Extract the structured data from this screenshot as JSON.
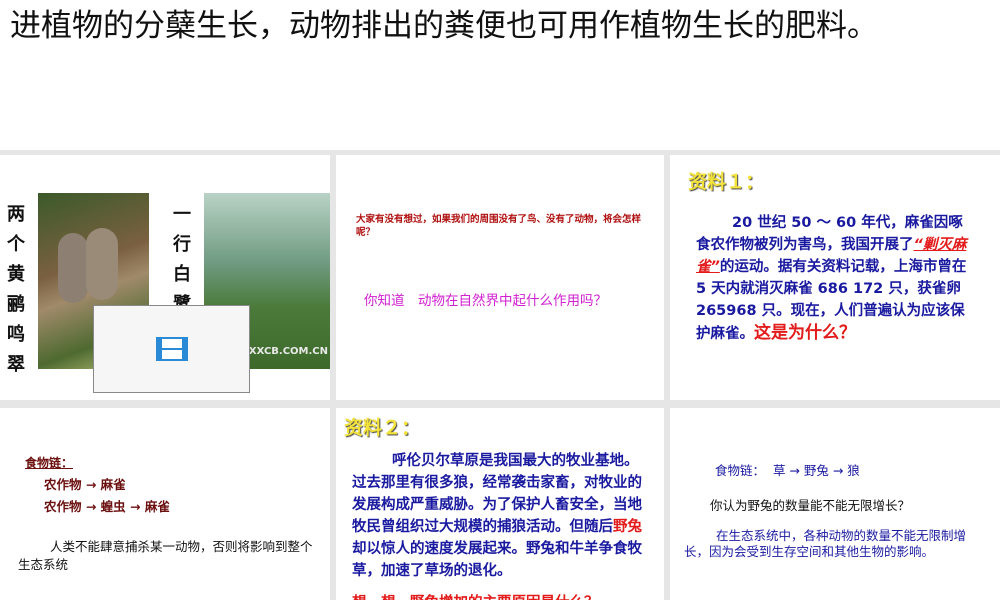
{
  "top_text": "进植物的分蘖生长，动物排出的粪便也可用作植物生长的肥料。",
  "slide1": {
    "poem_left": "两个黄鹂鸣翠",
    "poem_right": "一行白鹭",
    "watermark": "XXCB.COM.CN",
    "video_icon": "film-icon"
  },
  "slide2": {
    "question1": "大家有没有想过，如果我们的周围没有了鸟、没有了动物，将会怎样呢？",
    "question2": "你知道　动物在自然界中起什么作用吗？"
  },
  "slide3": {
    "heading": "资料１：",
    "p1": "20 世纪 50 ～ 60 年代，麻雀因啄食农作物被列为害鸟，我国开展了",
    "highlight": "“剿灭麻雀”",
    "p2": "的运动。据有关资料记载，上海市曾在 5 天内就消灭麻雀 686 172 只，获雀卵 265968 只。现在，人们普遍认为应该保护麻雀。",
    "question": "这是为什么？"
  },
  "slide4": {
    "title": "食物链：",
    "chain1": "农作物 → 麻雀",
    "chain2": "农作物 → 蝗虫 → 麻雀",
    "text": "人类不能肆意捕杀某一动物，否则将影响到整个生态系统"
  },
  "slide5": {
    "heading": "资料２：",
    "p1": "呼伦贝尔草原是我国最大的牧业基地。过去那里有很多狼，经常袭击家畜，对牧业的发展构成严重威胁。为了保护人畜安全，当地牧民曾组织过大规模的捕狼活动。但随后",
    "highlight": "野兔",
    "p2": "却以惊人的速度发展起来。野兔和牛羊争食牧草，加速了草场的退化。",
    "question": "想一想，野兔增加的主要原因是什么？"
  },
  "slide6": {
    "chain": "食物链：  草 → 野兔 → 狼",
    "question": "你认为野兔的数量能不能无限增长？",
    "answer": "在生态系统中，各种动物的数量不能无限制增长，因为会受到生存空间和其他生物的影响。"
  }
}
